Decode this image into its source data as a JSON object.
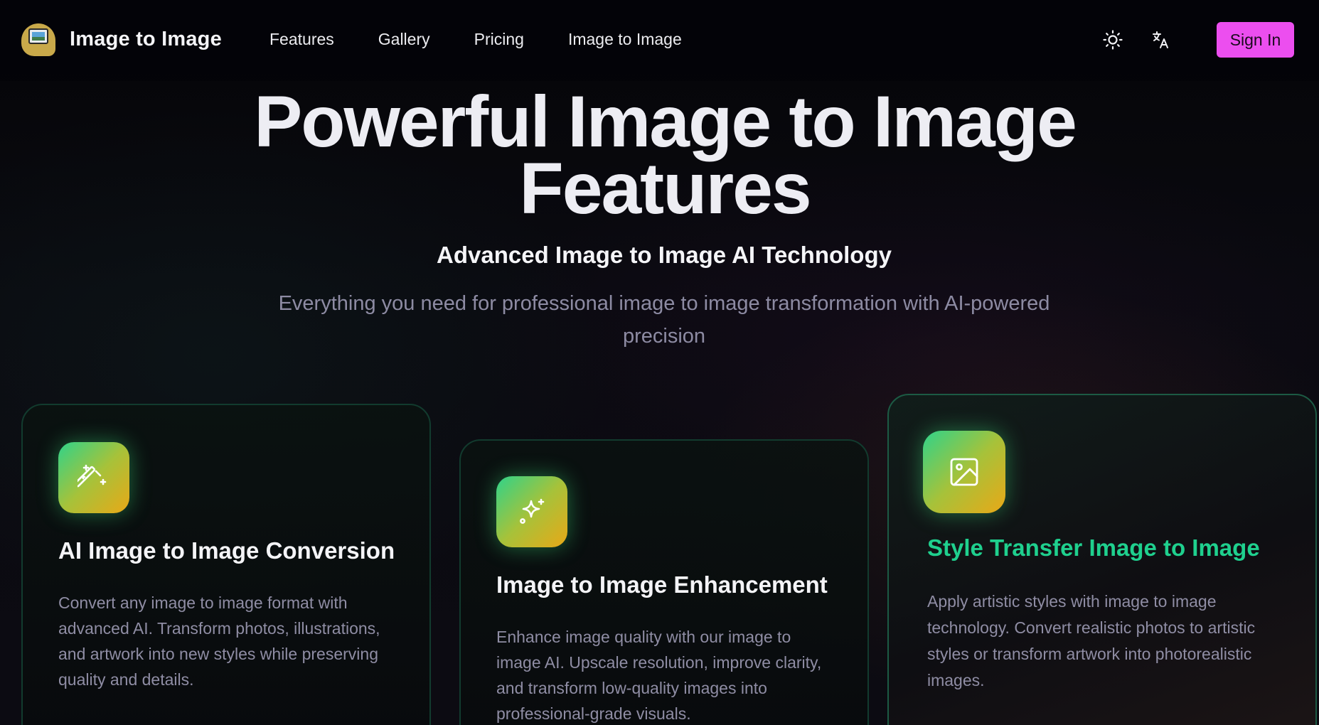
{
  "header": {
    "brand_name": "Image to Image",
    "nav": [
      "Features",
      "Gallery",
      "Pricing",
      "Image to Image"
    ],
    "theme_icon": "sun-icon",
    "language_icon": "translate-icon",
    "signin_label": "Sign In"
  },
  "hero": {
    "title_line1": "Powerful Image to Image",
    "title_line2": "Features",
    "subtitle": "Advanced Image to Image AI Technology",
    "description": "Everything you need for professional image to image transformation with AI-powered precision"
  },
  "cards": [
    {
      "icon": "magic-wand-icon",
      "title": "AI Image to Image Conversion",
      "description": "Convert any image to image format with advanced AI. Transform photos, illustrations, and artwork into new styles while preserving quality and details."
    },
    {
      "icon": "sparkles-icon",
      "title": "Image to Image Enhancement",
      "description": "Enhance image quality with our image to image AI. Upscale resolution, improve clarity, and transform low-quality images into professional-grade visuals."
    },
    {
      "icon": "image-icon",
      "title": "Style Transfer Image to Image",
      "description": "Apply artistic styles with image to image technology. Convert realistic photos to artistic styles or transform artwork into photorealistic images."
    }
  ],
  "colors": {
    "accent_pink": "#ec4eef",
    "accent_green": "#1fd08e",
    "background": "#08080c"
  }
}
